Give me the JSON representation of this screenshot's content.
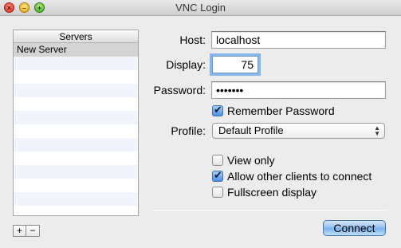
{
  "window": {
    "title": "VNC Login",
    "traffic_lights": [
      "close-icon",
      "minimize-icon",
      "zoom-icon"
    ]
  },
  "servers": {
    "header": "Servers",
    "items": [
      "New Server"
    ],
    "selected_index": 0,
    "add_label": "+",
    "remove_label": "−"
  },
  "form": {
    "host_label": "Host:",
    "host_value": "localhost",
    "display_label": "Display:",
    "display_value": "75",
    "password_label": "Password:",
    "password_value": "•••••••",
    "remember_password_label": "Remember Password",
    "remember_password_checked": true,
    "profile_label": "Profile:",
    "profile_value": "Default Profile",
    "view_only_label": "View only",
    "view_only_checked": false,
    "allow_others_label": "Allow other clients to connect",
    "allow_others_checked": true,
    "fullscreen_label": "Fullscreen display",
    "fullscreen_checked": false
  },
  "actions": {
    "connect_label": "Connect"
  },
  "colors": {
    "accent": "#4f8fe0",
    "window_bg": "#ececec",
    "selected_row": "#d4d4d4"
  }
}
